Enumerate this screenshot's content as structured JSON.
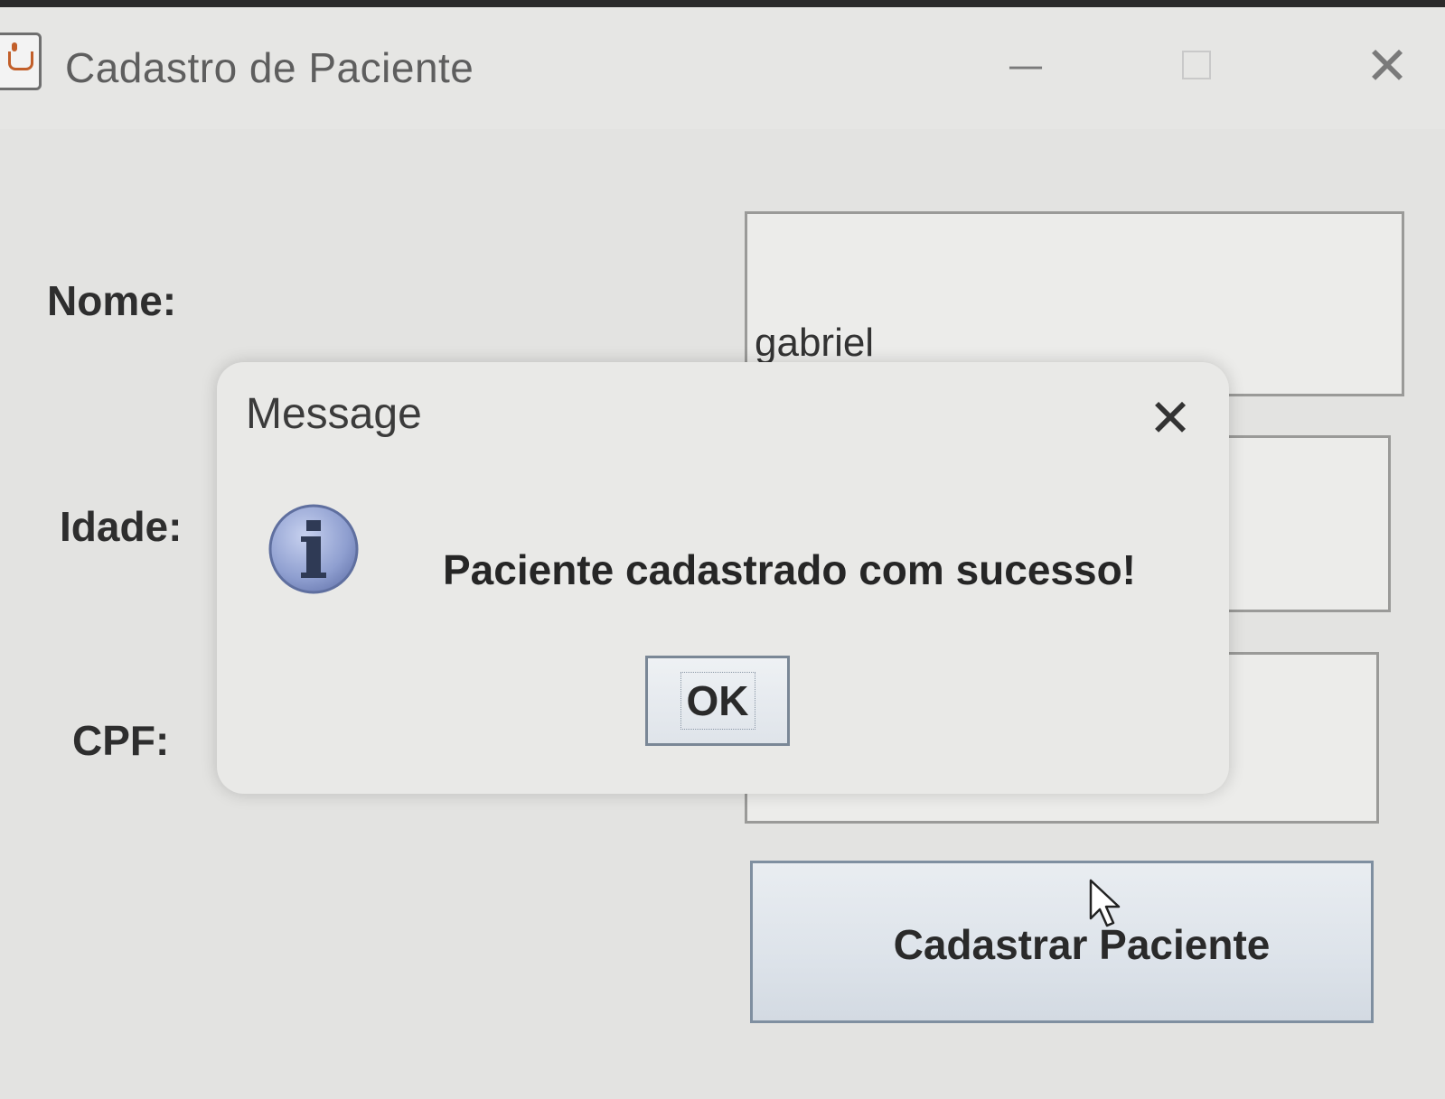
{
  "window": {
    "title": "Cadastro de Paciente",
    "minimize_glyph": "—",
    "close_glyph": "✕"
  },
  "form": {
    "nome_label": "Nome:",
    "nome_value": "gabriel",
    "idade_label": "Idade:",
    "idade_value": "",
    "cpf_label": "CPF:",
    "cpf_value": "",
    "submit_label": "Cadastrar Paciente"
  },
  "dialog": {
    "title": "Message",
    "close_glyph": "✕",
    "icon": "info-icon",
    "message": "Paciente cadastrado com sucesso!",
    "ok_label": "OK"
  },
  "colors": {
    "window_bg": "#e3e3e1",
    "dialog_bg": "#e9e9e7",
    "info_icon_fill": "#8f9fd0",
    "button_border": "#7f8fa0"
  }
}
